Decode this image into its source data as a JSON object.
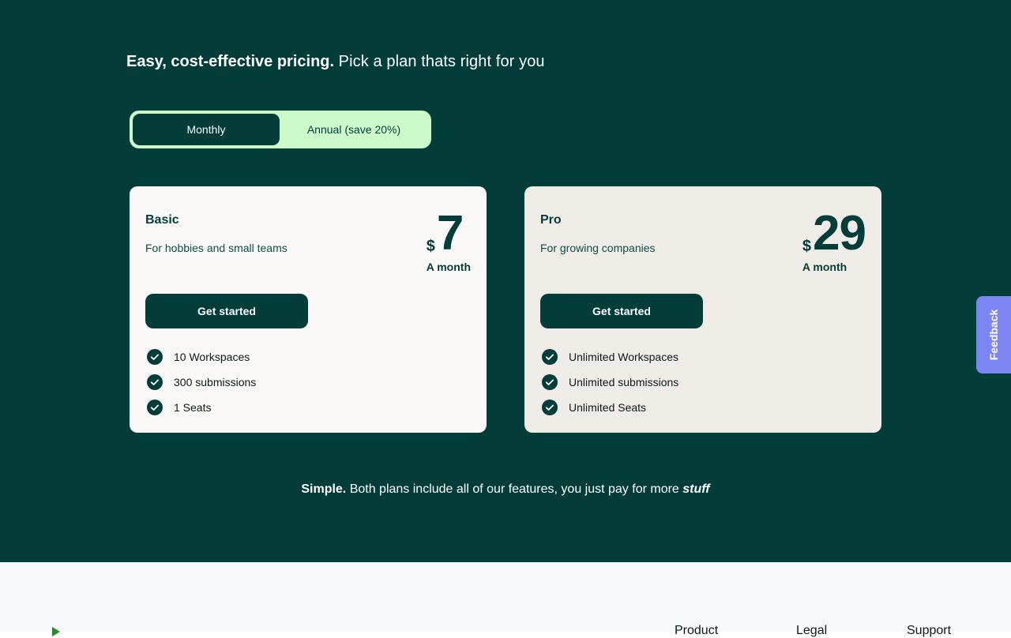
{
  "headline": {
    "strong": "Easy, cost-effective pricing.",
    "rest": "Pick a plan thats right for you"
  },
  "billing_toggle": {
    "monthly_label": "Monthly",
    "annual_label": "Annual (save 20%)",
    "selected": "Monthly"
  },
  "plans": [
    {
      "name": "Basic",
      "description": "For hobbies and small teams",
      "currency": "$",
      "price": "7",
      "period": "A month",
      "cta_label": "Get started",
      "features": [
        "10 Workspaces",
        "300 submissions",
        "1 Seats"
      ]
    },
    {
      "name": "Pro",
      "description": "For growing companies",
      "currency": "$",
      "price": "29",
      "period": "A month",
      "cta_label": "Get started",
      "features": [
        "Unlimited Workspaces",
        "Unlimited submissions",
        "Unlimited Seats"
      ]
    }
  ],
  "footnote": {
    "strong": "Simple.",
    "text": " Both plans include all of our features, you just pay for more ",
    "em": "stuff"
  },
  "feedback_tab": {
    "label": "Feedback"
  },
  "footer": {
    "columns": [
      "Product",
      "Legal",
      "Support"
    ]
  },
  "colors": {
    "brand_dark": "#023d3a",
    "brand_light": "#cdfacb",
    "feedback": "#7c86f2",
    "card_basic": "#faf8f6",
    "card_pro": "#efebe7"
  },
  "icons": {
    "feature_check": "check-circle-icon",
    "logo": "logo-icon"
  }
}
